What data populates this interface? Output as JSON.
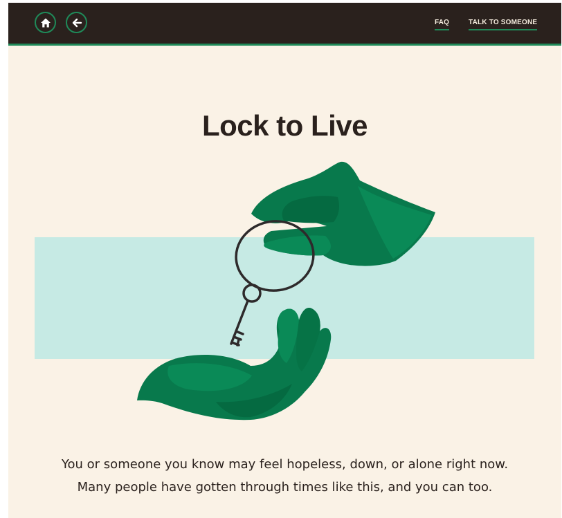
{
  "header": {
    "home_icon": "home-icon",
    "back_icon": "arrow-left-icon",
    "nav": {
      "faq_label": "FAQ",
      "talk_label": "TALK TO SOMEONE"
    }
  },
  "main": {
    "title": "Lock to Live",
    "illustration_icon": "hands-passing-key-illustration",
    "body_line1": "You or someone you know may feel hopeless, down, or alone right now.",
    "body_line2": "Many people have gotten through times like this, and you can too."
  },
  "colors": {
    "header_bg": "#2a211d",
    "accent_green": "#1f8a59",
    "page_bg": "#faf2e6",
    "illustration_band": "#c6eae4",
    "hand_green": "#08794c",
    "text_dark": "#2a211d"
  }
}
